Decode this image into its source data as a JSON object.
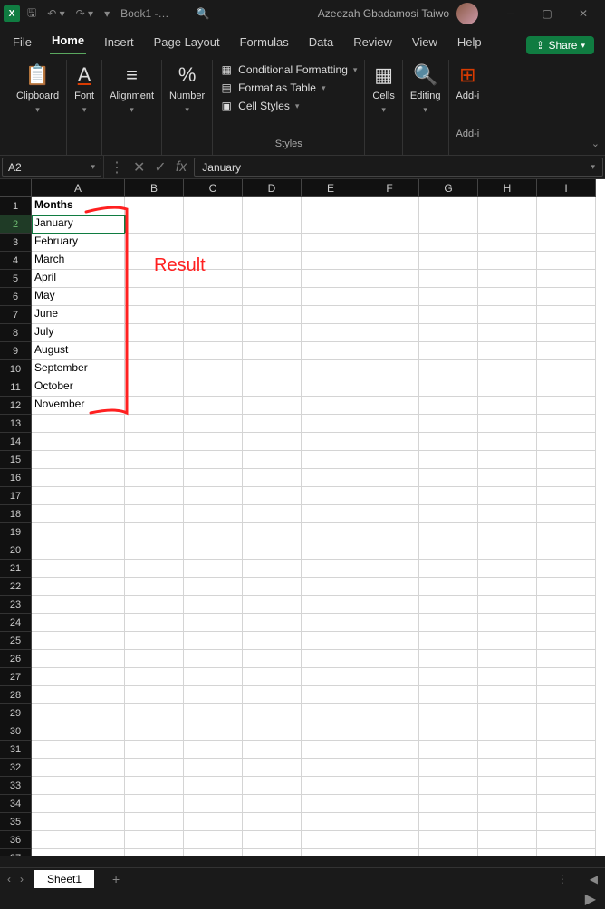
{
  "titlebar": {
    "app_icon": "X",
    "doc_title": "Book1 -…",
    "user_name": "Azeezah Gbadamosi Taiwo"
  },
  "tabs": {
    "items": [
      "File",
      "Home",
      "Insert",
      "Page Layout",
      "Formulas",
      "Data",
      "Review",
      "View",
      "Help"
    ],
    "active_index": 1,
    "share": "Share"
  },
  "ribbon": {
    "clipboard": "Clipboard",
    "font": "Font",
    "alignment": "Alignment",
    "number": "Number",
    "styles_items": {
      "conditional": "Conditional Formatting",
      "table": "Format as Table",
      "cell_styles": "Cell Styles"
    },
    "styles_label": "Styles",
    "cells": "Cells",
    "editing": "Editing",
    "addins": "Add-i",
    "addins_full": "Add-i"
  },
  "formula_bar": {
    "name_box": "A2",
    "formula": "January"
  },
  "grid": {
    "columns": [
      "A",
      "B",
      "C",
      "D",
      "E",
      "F",
      "G",
      "H",
      "I"
    ],
    "row_count": 37,
    "selected_cell": {
      "row": 2,
      "col": "A"
    },
    "data": {
      "A1": "Months",
      "A2": "January",
      "A3": "February",
      "A4": "March",
      "A5": "April",
      "A6": "May",
      "A7": "June",
      "A8": "July",
      "A9": "August",
      "A10": "September",
      "A11": "October",
      "A12": "November"
    }
  },
  "annotation": {
    "text": "Result"
  },
  "sheet_bar": {
    "sheet": "Sheet1"
  }
}
